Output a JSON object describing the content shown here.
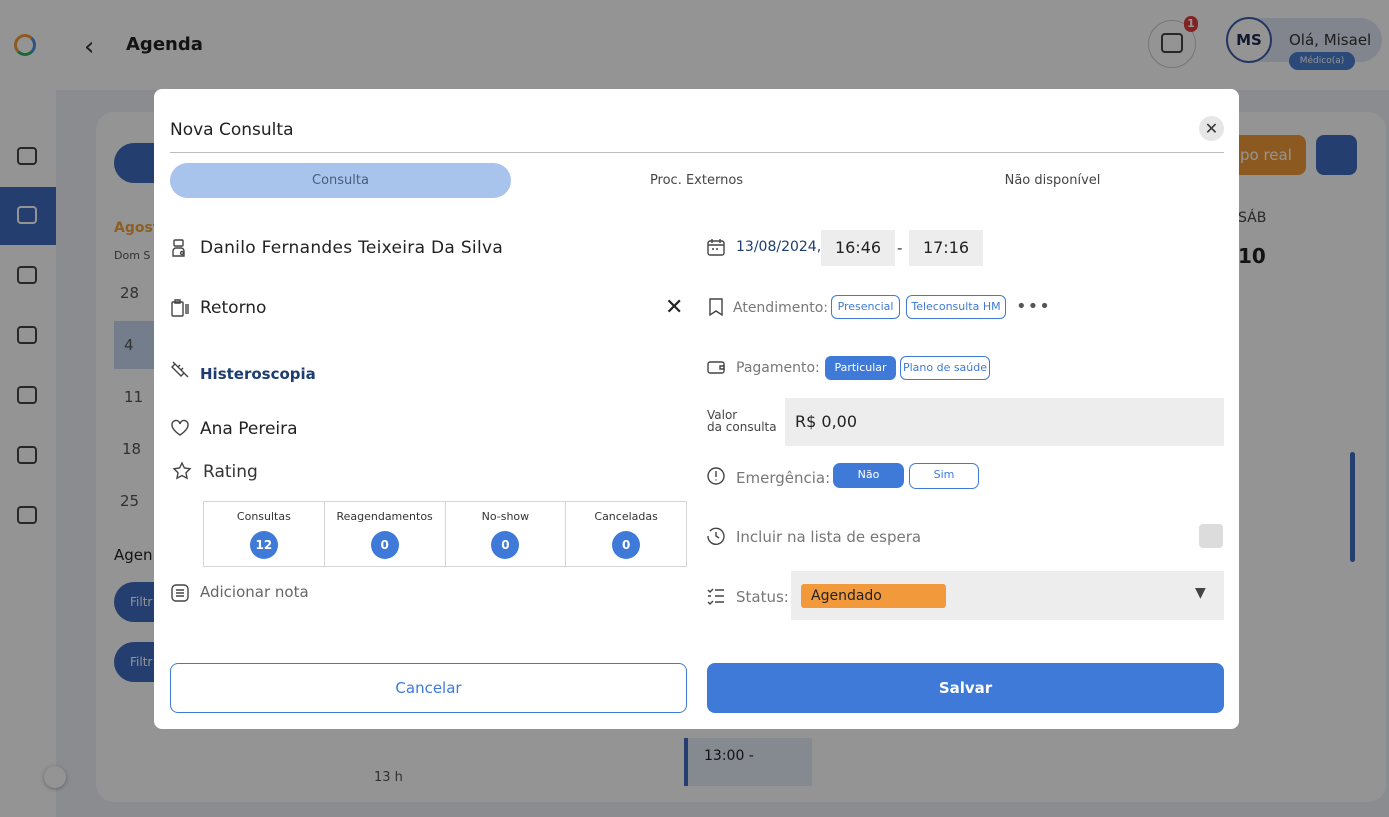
{
  "topbar": {
    "page_title": "Agenda",
    "notification_count": "1",
    "avatar_initials": "MS",
    "greeting": "Olá, Misael",
    "role": "Médico(a)"
  },
  "background": {
    "month": "Agost",
    "weekday_short": "Dom S",
    "days": [
      "28",
      "4",
      "11",
      "18",
      "25"
    ],
    "agenda_label": "Agen",
    "filter_label": "Filtr",
    "realtime_label": "po real",
    "sab": "SÁB",
    "sab_num": "10",
    "event_time": "13:00 -",
    "hour_label": "13 h"
  },
  "modal": {
    "title": "Nova Consulta",
    "tabs": [
      {
        "label": "Consulta",
        "active": true
      },
      {
        "label": "Proc. Externos",
        "active": false
      },
      {
        "label": "Não disponível",
        "active": false
      }
    ],
    "patient_name": "Danilo  Fernandes Teixeira Da Silva",
    "consult_type": "Retorno",
    "procedure": "Histeroscopia",
    "insurer": "Ana Pereira",
    "rating_label": "Rating",
    "stats": [
      {
        "label": "Consultas",
        "count": "12"
      },
      {
        "label": "Reagendamentos",
        "count": "0"
      },
      {
        "label": "No-show",
        "count": "0"
      },
      {
        "label": "Canceladas",
        "count": "0"
      }
    ],
    "add_note": "Adicionar nota",
    "date": "13/08/2024",
    "date_sep": ",",
    "time_start": "16:46",
    "time_dash": "-",
    "time_end": "17:16",
    "attendance_label": "Atendimento:",
    "attendance_options": [
      "Presencial",
      "Teleconsulta HM"
    ],
    "payment_label": "Pagamento:",
    "payment_options": [
      "Particular",
      "Plano de saúde"
    ],
    "fee_label_line1": "Valor",
    "fee_label_line2": "da consulta",
    "fee_value": "R$ 0,00",
    "emergency_label": "Emergência:",
    "emergency_options": [
      "Não",
      "Sim"
    ],
    "waitlist_label": "Incluir na lista de espera",
    "status_label": "Status:",
    "status_value": "Agendado",
    "cancel_label": "Cancelar",
    "save_label": "Salvar"
  },
  "colors": {
    "accent": "#3f7ad9",
    "active_tab": "#a8c3ec",
    "status_orange": "#f29a3b",
    "navy_text": "#1d3d70"
  },
  "icons": [
    "back-arrow-icon",
    "chat-icon",
    "doctor-icon",
    "clipboard-icon",
    "syringe-icon",
    "heart-icon",
    "star-icon",
    "note-icon",
    "calendar-icon",
    "bookmark-icon",
    "wallet-icon",
    "alert-icon",
    "history-icon",
    "checklist-icon",
    "close-icon",
    "more-icon",
    "chevron-down-icon"
  ]
}
